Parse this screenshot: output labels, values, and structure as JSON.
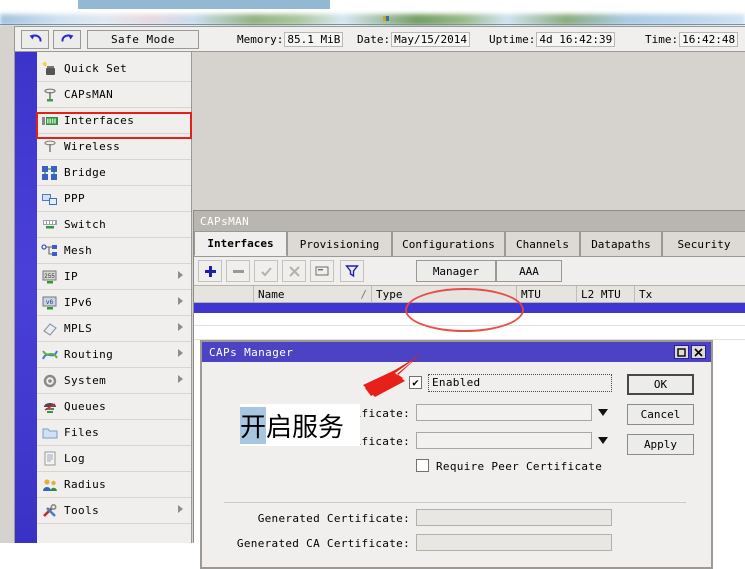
{
  "app": {
    "toolbar": {
      "undo_icon": "undo-arrow-icon",
      "redo_icon": "redo-arrow-icon",
      "safe_mode_label": "Safe Mode",
      "status": [
        {
          "label": "Memory:",
          "value": "85.1 MiB"
        },
        {
          "label": "Date:",
          "value": "May/15/2014"
        },
        {
          "label": "Uptime:",
          "value": "4d 16:42:39"
        },
        {
          "label": "Time:",
          "value": "16:42:48"
        }
      ]
    }
  },
  "sidebar": {
    "items": [
      {
        "label": "Quick Set",
        "icon": "quickset-icon",
        "submenu": false
      },
      {
        "label": "CAPsMAN",
        "icon": "capsman-antenna-icon",
        "submenu": false
      },
      {
        "label": "Interfaces",
        "icon": "interfaces-icon",
        "submenu": false
      },
      {
        "label": "Wireless",
        "icon": "wireless-antenna-icon",
        "submenu": false
      },
      {
        "label": "Bridge",
        "icon": "bridge-icon",
        "submenu": false
      },
      {
        "label": "PPP",
        "icon": "ppp-icon",
        "submenu": false
      },
      {
        "label": "Switch",
        "icon": "switch-icon",
        "submenu": false
      },
      {
        "label": "Mesh",
        "icon": "mesh-icon",
        "submenu": false
      },
      {
        "label": "IP",
        "icon": "ip-icon",
        "submenu": true
      },
      {
        "label": "IPv6",
        "icon": "ipv6-icon",
        "submenu": true
      },
      {
        "label": "MPLS",
        "icon": "mpls-icon",
        "submenu": true
      },
      {
        "label": "Routing",
        "icon": "routing-icon",
        "submenu": true
      },
      {
        "label": "System",
        "icon": "system-gear-icon",
        "submenu": true
      },
      {
        "label": "Queues",
        "icon": "queues-icon",
        "submenu": false
      },
      {
        "label": "Files",
        "icon": "folder-icon",
        "submenu": false
      },
      {
        "label": "Log",
        "icon": "log-icon",
        "submenu": false
      },
      {
        "label": "Radius",
        "icon": "radius-users-icon",
        "submenu": false
      },
      {
        "label": "Tools",
        "icon": "tools-icon",
        "submenu": true
      }
    ]
  },
  "capsman_window": {
    "title": "CAPsMAN",
    "tabs": [
      {
        "label": "Interfaces",
        "active": true
      },
      {
        "label": "Provisioning",
        "active": false
      },
      {
        "label": "Configurations",
        "active": false
      },
      {
        "label": "Channels",
        "active": false
      },
      {
        "label": "Datapaths",
        "active": false
      },
      {
        "label": "Security",
        "active": false
      }
    ],
    "row_toolbar": {
      "add_icon": "plus-icon",
      "remove_icon": "minus-icon",
      "enable_icon": "check-icon",
      "disable_icon": "cross-icon",
      "comment_icon": "comment-box-icon",
      "filter_icon": "filter-funnel-icon",
      "manager_label": "Manager",
      "aaa_label": "AAA"
    },
    "columns": [
      "Name",
      "Type",
      "MTU",
      "L2 MTU",
      "Tx"
    ],
    "sort_indicator": "/"
  },
  "dialog": {
    "title": "CAPs Manager",
    "maximize_icon": "maximize-icon",
    "close_icon": "close-icon",
    "enabled": {
      "label": "Enabled",
      "checked": true
    },
    "fields": [
      {
        "label": "Certificate:",
        "value": "",
        "type": "dropdown"
      },
      {
        "label": "CA Certificate:",
        "value": "",
        "type": "dropdown"
      }
    ],
    "require_peer": {
      "label": "Require Peer Certificate",
      "checked": false
    },
    "readonly_fields": [
      {
        "label": "Generated Certificate:",
        "value": ""
      },
      {
        "label": "Generated CA Certificate:",
        "value": ""
      }
    ],
    "buttons": {
      "ok": "OK",
      "cancel": "Cancel",
      "apply": "Apply"
    }
  },
  "annotations": {
    "chinese_note_highlighted": "开",
    "chinese_note_rest": "启服务",
    "arrow_color": "#e8201a",
    "highlight_color": "#e32119",
    "circle_color": "#e8463f"
  }
}
